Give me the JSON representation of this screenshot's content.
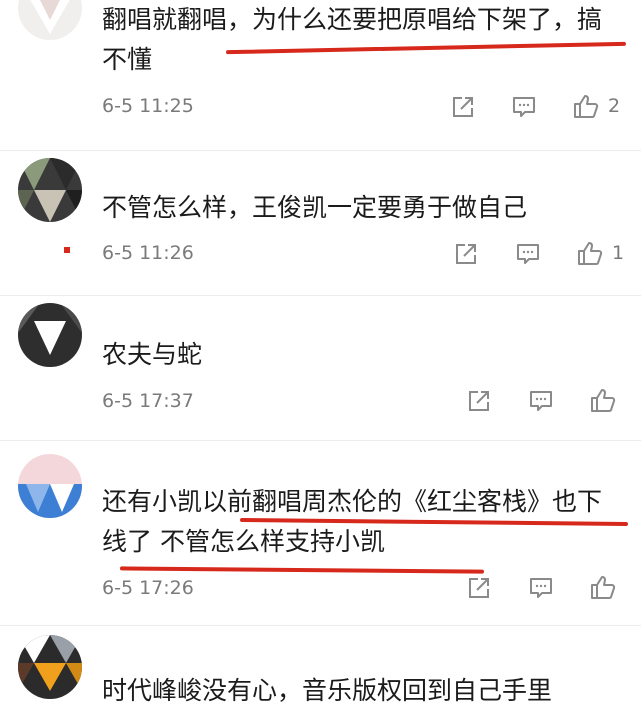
{
  "comments": [
    {
      "text": "翻唱就翻唱，为什么还要把原唱给下架了，搞不懂",
      "time": "6-5 11:25",
      "likes": "2"
    },
    {
      "text": "不管怎么样，王俊凯一定要勇于做自己",
      "time": "6-5 11:26",
      "likes": "1"
    },
    {
      "text": "农夫与蛇",
      "time": "6-5 17:37",
      "likes": ""
    },
    {
      "text": "还有小凯以前翻唱周杰伦的《红尘客栈》也下线了 不管怎么样支持小凯",
      "time": "6-5 17:26",
      "likes": ""
    },
    {
      "text": "时代峰峻没有心，音乐版权回到自己手里"
    }
  ],
  "colors": {
    "highlight_underline": "#d7281c",
    "meta_text": "#7a7a7a"
  },
  "icons": {
    "repost": "share-box-icon",
    "comment": "comment-bubble-icon",
    "like": "thumbs-up-icon"
  }
}
